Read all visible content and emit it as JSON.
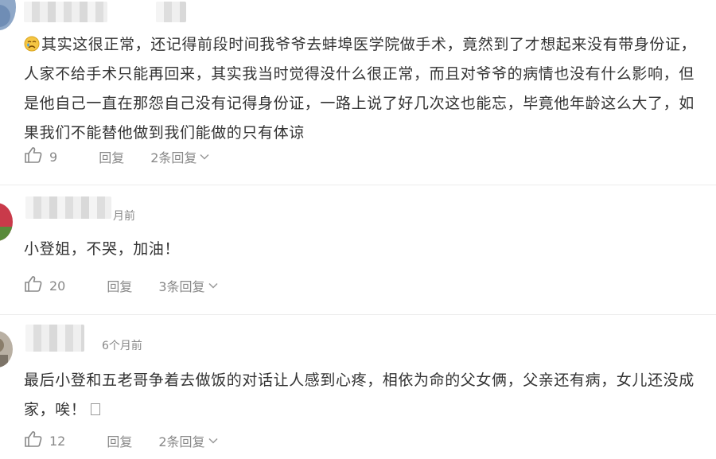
{
  "comments": [
    {
      "time": "",
      "text": "其实这很正常，还记得前段时间我爷爷去蚌埠医学院做手术，竟然到了才想起来没有带身份证，人家不给手术只能再回来，其实我当时觉得没什么很正常，而且对爷爷的病情也没有什么影响，但是他自己一直在那怨自己没有记得身份证，一路上说了好几次这也能忘，毕竟他年龄这么大了，如果我们不能替他做到我们能做的只有体谅",
      "leading_icon": "crying-face-emoji",
      "likes": "9",
      "reply_label": "回复",
      "replies_label": "2条回复"
    },
    {
      "time": "月前",
      "text": "小登姐，不哭，加油！",
      "likes": "20",
      "reply_label": "回复",
      "replies_label": "3条回复"
    },
    {
      "time": "6个月前",
      "text": "最后小登和五老哥争着去做饭的对话让人感到心疼，相依为命的父女俩，父亲还有病，女儿还没成家，唉！",
      "trailing_icon": "missing-glyph-box",
      "likes": "12",
      "reply_label": "回复",
      "replies_label": "2条回复"
    }
  ],
  "colors": {
    "text": "#333333",
    "muted": "#888888",
    "divider": "#ececec",
    "background": "#ffffff"
  }
}
